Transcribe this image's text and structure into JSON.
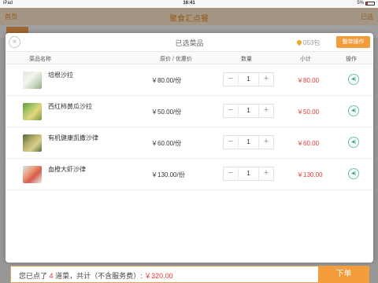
{
  "status_bar": {
    "device": "iPad",
    "time": "16:41",
    "battery": "5%"
  },
  "background": {
    "back_label": "首页",
    "title": "聚食汇点餐",
    "right_label": "已选"
  },
  "modal": {
    "title": "已选菜品",
    "pack_label": "053包",
    "op_button": "整单操作",
    "columns": {
      "name": "菜品名称",
      "price": "原价 / 优惠价",
      "qty": "数量",
      "subtotal": "小计",
      "action": "操作"
    },
    "items": [
      {
        "name": "培根沙拉",
        "price": "￥80.00/份",
        "qty": "1",
        "subtotal": "￥80.00"
      },
      {
        "name": "西红柿黄瓜沙拉",
        "price": "￥50.00/份",
        "qty": "1",
        "subtotal": "￥50.00"
      },
      {
        "name": "有机健康凯撒沙律",
        "price": "￥60.00/份",
        "qty": "1",
        "subtotal": "￥60.00"
      },
      {
        "name": "血橙大虾沙律",
        "price": "￥130.00/份",
        "qty": "1",
        "subtotal": "￥130.00"
      }
    ],
    "minus": "−",
    "plus": "+",
    "delete_glyph": "◀|"
  },
  "bottom": {
    "prefix": "您已点了",
    "count": "4",
    "middle": "道菜，共计（不含服务费）:",
    "total": "￥320.00",
    "order_button": "下单"
  },
  "colors": {
    "accent": "#f39c3c",
    "price_red": "#e53935",
    "delete_green": "#3fae84"
  }
}
